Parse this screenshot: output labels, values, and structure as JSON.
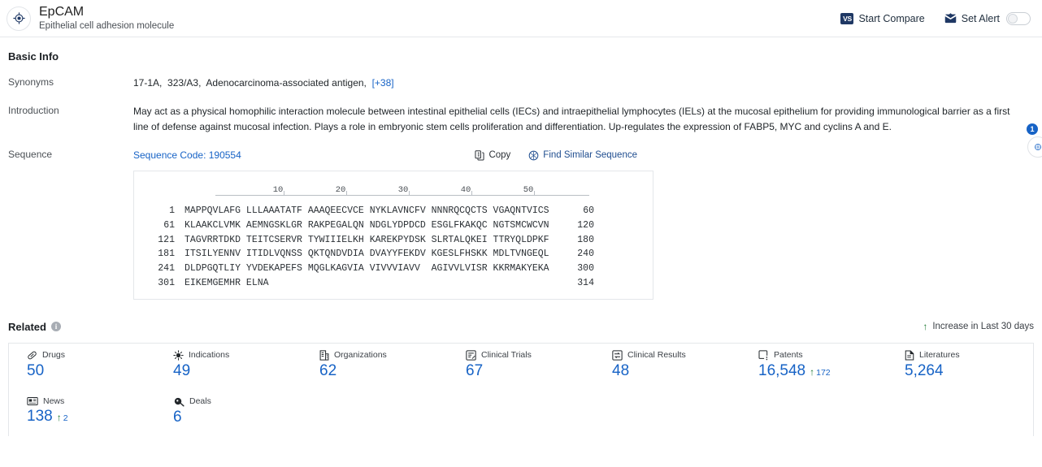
{
  "header": {
    "brand_icon": "target-crosshair-icon",
    "title": "EpCAM",
    "subtitle": "Epithelial cell adhesion molecule",
    "compare_badge": "VS",
    "compare_label": "Start Compare",
    "alert_label": "Set Alert",
    "alert_toggle_state": "off"
  },
  "basic_info": {
    "section_title": "Basic Info",
    "synonyms": {
      "label": "Synonyms",
      "items": [
        "17-1A,",
        "323/A3,",
        "Adenocarcinoma-associated antigen,"
      ],
      "more": "[+38]"
    },
    "introduction": {
      "label": "Introduction",
      "text": "May act as a physical homophilic interaction molecule between intestinal epithelial cells (IECs) and intraepithelial lymphocytes (IELs) at the mucosal epithelium for providing immunological barrier as a first line of defense against mucosal infection. Plays a role in embryonic stem cells proliferation and differentiation. Up-regulates the expression of FABP5, MYC and cyclins A and E."
    },
    "sequence": {
      "label": "Sequence",
      "code_label": "Sequence Code: 190554",
      "copy_label": "Copy",
      "find_similar_label": "Find Similar Sequence",
      "ruler_ticks": [
        "10",
        "20",
        "30",
        "40",
        "50"
      ],
      "rows": [
        {
          "start": "1",
          "body": "MAPPQVLAFG LLLAAATATF AAAQEECVCE NYKLAVNCFV NNNRQCQCTS VGAQNTVICS",
          "end": "60"
        },
        {
          "start": "61",
          "body": "KLAAKCLVMK AEMNGSKLGR RAKPEGALQN NDGLYDPDCD ESGLFKAKQC NGTSMCWCVN",
          "end": "120"
        },
        {
          "start": "121",
          "body": "TAGVRRTDKD TEITCSERVR TYWIIIELKH KAREKPYDSK SLRTALQKEI TTRYQLDPKF",
          "end": "180"
        },
        {
          "start": "181",
          "body": "ITSILYENNV ITIDLVQNSS QKTQNDVDIA DVAYYFEKDV KGESLFHSKK MDLTVNGEQL",
          "end": "240"
        },
        {
          "start": "241",
          "body": "DLDPGQTLIY YVDEKAPEFS MQGLKAGVIA VIVVVIAVV  AGIVVLVISR KKRMAKYEKA",
          "end": "300"
        },
        {
          "start": "301",
          "body": "EIKEMGEMHR ELNA",
          "end": "314"
        }
      ]
    }
  },
  "related": {
    "title": "Related",
    "legend_text": "Increase in Last 30 days",
    "cards": [
      {
        "icon": "pill-icon",
        "label": "Drugs",
        "value": "50",
        "delta": ""
      },
      {
        "icon": "virus-icon",
        "label": "Indications",
        "value": "49",
        "delta": ""
      },
      {
        "icon": "building-icon",
        "label": "Organizations",
        "value": "62",
        "delta": ""
      },
      {
        "icon": "clinical-trial-icon",
        "label": "Clinical Trials",
        "value": "67",
        "delta": ""
      },
      {
        "icon": "clinical-result-icon",
        "label": "Clinical Results",
        "value": "48",
        "delta": ""
      },
      {
        "icon": "patent-icon",
        "label": "Patents",
        "value": "16,548",
        "delta": "172"
      },
      {
        "icon": "literature-icon",
        "label": "Literatures",
        "value": "5,264",
        "delta": ""
      },
      {
        "icon": "news-icon",
        "label": "News",
        "value": "138",
        "delta": "2"
      },
      {
        "icon": "deals-icon",
        "label": "Deals",
        "value": "6",
        "delta": ""
      }
    ]
  },
  "side_panel": {
    "badge_count": "1"
  },
  "colors": {
    "link": "#1763c6",
    "accent_dark": "#1f3864",
    "increase": "#1e7a34"
  }
}
